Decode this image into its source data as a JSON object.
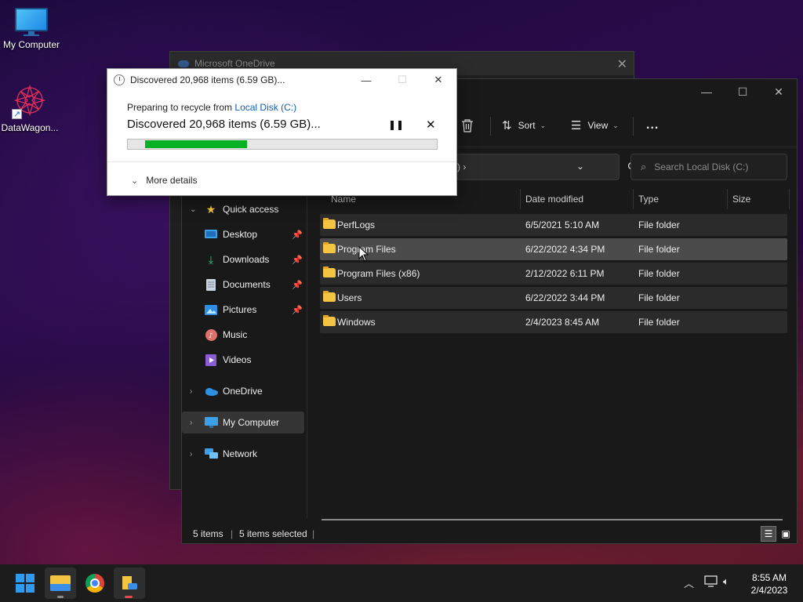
{
  "desktop": {
    "icons": [
      {
        "label": "My Computer",
        "icon": "monitor-icon"
      },
      {
        "label": "DataWagon...",
        "icon": "datawagon-logo-icon"
      }
    ]
  },
  "onedrive_window": {
    "title": "Microsoft OneDrive"
  },
  "explorer": {
    "toolbar": {
      "sort_label": "Sort",
      "view_label": "View",
      "more_label": "..."
    },
    "address": {
      "tail": ")  ›"
    },
    "search": {
      "placeholder": "Search Local Disk (C:)"
    },
    "nav": {
      "quick_access": "Quick access",
      "items": [
        {
          "label": "Desktop",
          "icon": "desktop-icon",
          "pinned": true
        },
        {
          "label": "Downloads",
          "icon": "downloads-icon",
          "pinned": true
        },
        {
          "label": "Documents",
          "icon": "documents-icon",
          "pinned": true
        },
        {
          "label": "Pictures",
          "icon": "pictures-icon",
          "pinned": true
        },
        {
          "label": "Music",
          "icon": "music-icon",
          "pinned": false
        },
        {
          "label": "Videos",
          "icon": "videos-icon",
          "pinned": false
        }
      ],
      "onedrive": "OneDrive",
      "my_computer": "My Computer",
      "network": "Network"
    },
    "columns": {
      "name": "Name",
      "date": "Date modified",
      "type": "Type",
      "size": "Size"
    },
    "files": [
      {
        "name": "PerfLogs",
        "date": "6/5/2021 5:10 AM",
        "type": "File folder"
      },
      {
        "name": "Program Files",
        "date": "6/22/2022 4:34 PM",
        "type": "File folder"
      },
      {
        "name": "Program Files (x86)",
        "date": "2/12/2022 6:11 PM",
        "type": "File folder"
      },
      {
        "name": "Users",
        "date": "6/22/2022 3:44 PM",
        "type": "File folder"
      },
      {
        "name": "Windows",
        "date": "2/4/2023 8:45 AM",
        "type": "File folder"
      }
    ],
    "status": {
      "items": "5 items",
      "selected": "5 items selected"
    }
  },
  "dialog": {
    "title": "Discovered 20,968 items (6.59 GB)...",
    "preparing": "Preparing to recycle from",
    "source_link": "Local Disk (C:)",
    "headline": "Discovered 20,968 items (6.59 GB)...",
    "progress": 0.35,
    "progress_color": "#06b025",
    "more_details": "More details"
  },
  "taskbar": {
    "apps": [
      "start-icon",
      "file-explorer-icon",
      "chrome-icon",
      "file-transfer-icon"
    ],
    "time": "8:55 AM",
    "date": "2/4/2023"
  }
}
